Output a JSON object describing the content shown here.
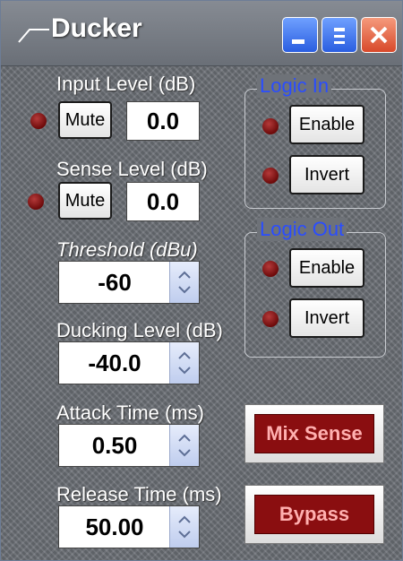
{
  "window": {
    "title": "Ducker",
    "colors": {
      "title_text": "#ffffff",
      "group_title": "#2a4dff",
      "led": "#8b0d0d",
      "red_button": "#8a0e10"
    }
  },
  "input_level": {
    "label": "Input Level (dB)",
    "mute_label": "Mute",
    "value": "0.0"
  },
  "sense_level": {
    "label": "Sense Level (dB)",
    "mute_label": "Mute",
    "value": "0.0"
  },
  "threshold": {
    "label": "Threshold (dBu)",
    "value": "-60"
  },
  "ducking_level": {
    "label": "Ducking Level (dB)",
    "value": "-40.0"
  },
  "attack_time": {
    "label": "Attack Time (ms)",
    "value": "0.50"
  },
  "release_time": {
    "label": "Release Time (ms)",
    "value": "50.00"
  },
  "logic_in": {
    "title": "Logic In",
    "enable_label": "Enable",
    "invert_label": "Invert"
  },
  "logic_out": {
    "title": "Logic Out",
    "enable_label": "Enable",
    "invert_label": "Invert"
  },
  "buttons": {
    "mix_sense": "Mix Sense",
    "bypass": "Bypass"
  },
  "icons": [
    "title-mark-icon",
    "minimize-icon",
    "maximize-icon",
    "close-icon",
    "led-indicator-icon",
    "spin-arrows-icon"
  ]
}
